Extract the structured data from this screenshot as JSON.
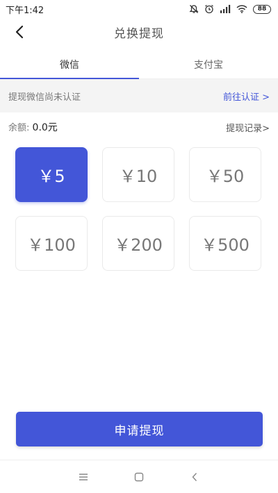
{
  "status_bar": {
    "time": "下午1:42",
    "battery": "88",
    "icons": [
      "mute-bell-icon",
      "alarm-icon",
      "signal-icon",
      "wifi-icon",
      "battery-icon"
    ]
  },
  "header": {
    "title": "兑换提现",
    "back_icon": "chevron-left-icon"
  },
  "tabs": [
    {
      "label": "微信",
      "active": true
    },
    {
      "label": "支付宝",
      "active": false
    }
  ],
  "notice": {
    "text": "提现微信尚未认证",
    "link": "前往认证 >"
  },
  "balance": {
    "label": "余额:",
    "value": "0.0元",
    "records_link": "提现记录>"
  },
  "amounts": [
    {
      "label": "￥5",
      "selected": true
    },
    {
      "label": "￥10",
      "selected": false
    },
    {
      "label": "￥50",
      "selected": false
    },
    {
      "label": "￥100",
      "selected": false
    },
    {
      "label": "￥200",
      "selected": false
    },
    {
      "label": "￥500",
      "selected": false
    }
  ],
  "submit": {
    "label": "申请提现"
  },
  "colors": {
    "accent": "#4356d8",
    "notice_bg": "#f4f4f4"
  },
  "system_nav": [
    "menu-icon",
    "home-icon",
    "back-icon"
  ]
}
